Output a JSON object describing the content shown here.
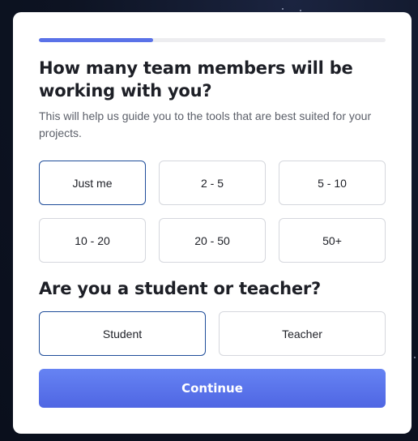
{
  "progress": {
    "fraction": 0.33
  },
  "team_question": {
    "title": "How many team members will be working with you?",
    "subtitle": "This will help us guide you to the tools that are best suited for your projects.",
    "options": [
      "Just me",
      "2 - 5",
      "5 - 10",
      "10 - 20",
      "20 - 50",
      "50+"
    ],
    "selected": "Just me"
  },
  "role_question": {
    "title": "Are you a student or teacher?",
    "options": [
      "Student",
      "Teacher"
    ],
    "selected": "Student"
  },
  "continue_label": "Continue",
  "colors": {
    "accent": "#5a72e8",
    "selected_border": "#1f4d9a",
    "backdrop": "#0e1425"
  }
}
